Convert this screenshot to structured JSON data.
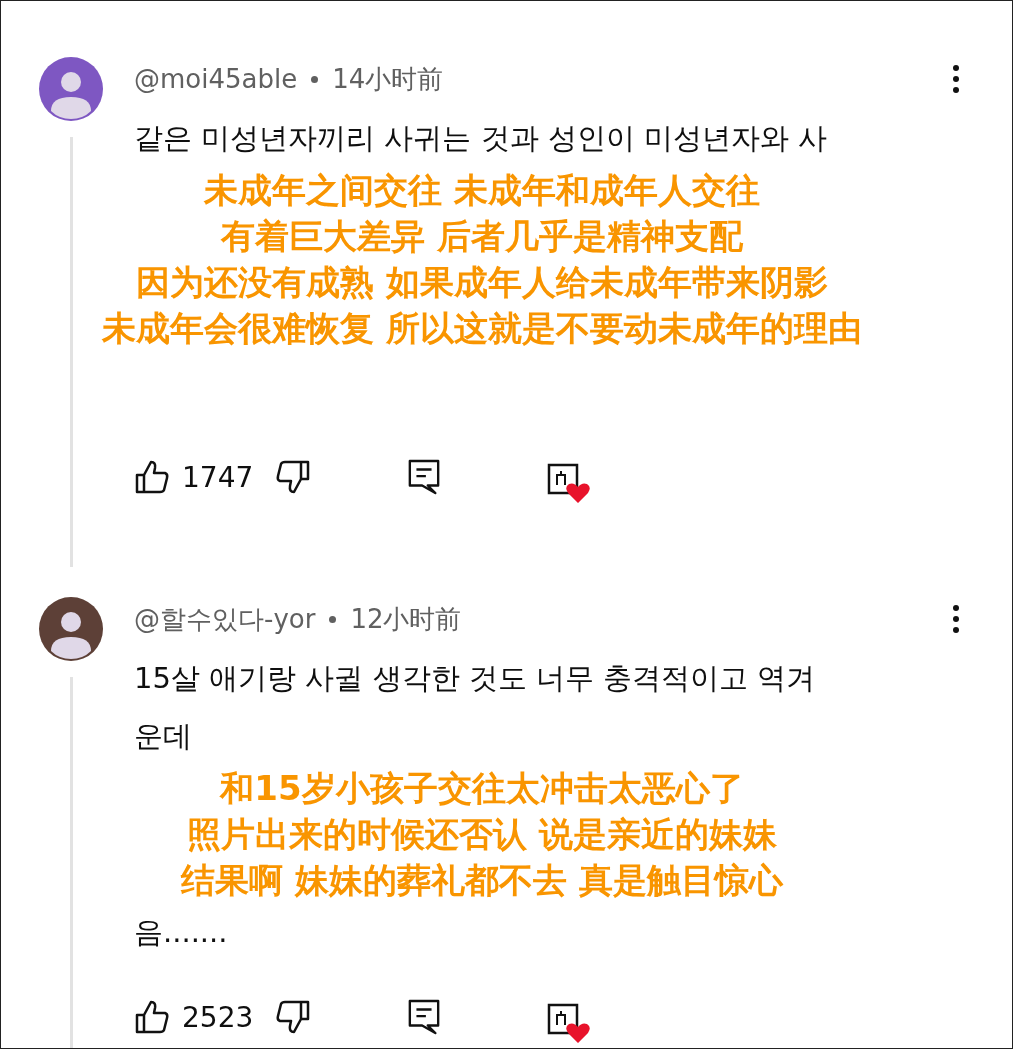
{
  "comments": [
    {
      "color": "#7e57c2",
      "author": "@moi45able",
      "time": "14小时前",
      "likes": "1747",
      "body": [
        {
          "kind": "line",
          "text": "같은 미성년자끼리 사귀는 것과 성인이 미성년자와 사"
        },
        {
          "kind": "caption",
          "lines": [
            "未成年之间交往 未成年和成年人交往",
            "有着巨大差异 后者几乎是精神支配",
            "因为还没有成熟 如果成年人给未成年带来阴影",
            "未成年会很难恢复 所以这就是不要动未成年的理由"
          ]
        }
      ]
    },
    {
      "color": "#5d4037",
      "author": "@할수있다-yor",
      "time": "12小时前",
      "likes": "2523",
      "body": [
        {
          "kind": "line",
          "text": "15살 애기랑 사귈 생각한 것도 너무 충격적이고 역겨"
        },
        {
          "kind": "line",
          "text": "운데"
        },
        {
          "kind": "caption",
          "lines": [
            "和15岁小孩子交往太冲击太恶心了",
            "照片出来的时候还否认 说是亲近的妹妹",
            "结果啊 妹妹的葬礼都不去 真是触目惊心"
          ]
        },
        {
          "kind": "line",
          "text": "음......."
        }
      ]
    }
  ]
}
